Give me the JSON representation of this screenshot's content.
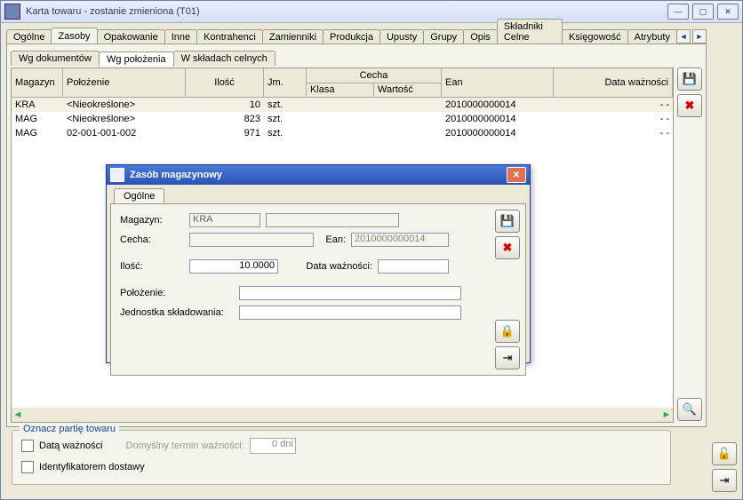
{
  "window": {
    "title": "Karta towaru - zostanie zmieniona (T01)"
  },
  "tabs": [
    "Ogólne",
    "Zasoby",
    "Opakowanie",
    "Inne",
    "Kontrahenci",
    "Zamienniki",
    "Produkcja",
    "Upusty",
    "Grupy",
    "Opis",
    "Składniki Celne",
    "Księgowość",
    "Atrybuty"
  ],
  "tabs_active_index": 1,
  "subtabs": [
    "Wg dokumentów",
    "Wg położenia",
    "W składach celnych"
  ],
  "subtabs_active_index": 1,
  "grid": {
    "headers": {
      "magazyn": "Magazyn",
      "polozenie": "Położenie",
      "ilosc": "Ilość",
      "jm": "Jm.",
      "cecha": "Cecha",
      "cecha_klasa": "Klasa",
      "cecha_wartosc": "Wartość",
      "ean": "Ean",
      "data_waznosci": "Data ważności"
    },
    "rows": [
      {
        "magazyn": "KRA",
        "polozenie": "<Nieokreślone>",
        "ilosc": "10",
        "jm": "szt.",
        "klasa": "",
        "wartosc": "",
        "ean": "2010000000014",
        "data": "- -"
      },
      {
        "magazyn": "MAG",
        "polozenie": "<Nieokreślone>",
        "ilosc": "823",
        "jm": "szt.",
        "klasa": "",
        "wartosc": "",
        "ean": "2010000000014",
        "data": "- -"
      },
      {
        "magazyn": "MAG",
        "polozenie": "02-001-001-002",
        "ilosc": "971",
        "jm": "szt.",
        "klasa": "",
        "wartosc": "",
        "ean": "2010000000014",
        "data": "- -"
      }
    ]
  },
  "batch_group": {
    "legend": "Oznacz partię towaru",
    "opt_data_waznosci": "Datą ważności",
    "default_term_label": "Domyślny termin ważności:",
    "default_term_value": "0 dni",
    "opt_ident_dostawy": "Identyfikatorem dostawy"
  },
  "dialog": {
    "title": "Zasób magazynowy",
    "tab": "Ogólne",
    "labels": {
      "magazyn": "Magazyn:",
      "cecha": "Cecha:",
      "ean": "Ean:",
      "ilosc": "Ilość:",
      "data_waznosci": "Data ważności:",
      "polozenie": "Położenie:",
      "jednostka": "Jednostka składowania:"
    },
    "values": {
      "magazyn": "KRA",
      "cecha": "",
      "ean": "2010000000014",
      "ilosc": "10.0000",
      "data_waznosci": "",
      "polozenie": "",
      "jednostka": ""
    }
  },
  "icons": {
    "save": "💾",
    "delete": "✖",
    "lock": "🔒",
    "unlock": "🔓",
    "exit": "⇥",
    "search": "🔍",
    "left": "◄",
    "right": "►",
    "min": "—",
    "max": "▢",
    "close": "✕"
  }
}
